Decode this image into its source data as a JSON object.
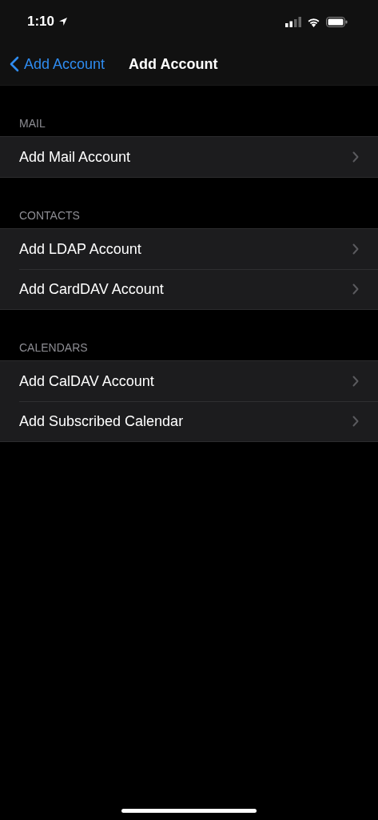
{
  "status_bar": {
    "time": "1:10"
  },
  "nav": {
    "back": "Add Account",
    "title": "Add Account"
  },
  "sections": [
    {
      "header": "MAIL",
      "rows": [
        {
          "label": "Add Mail Account"
        }
      ]
    },
    {
      "header": "CONTACTS",
      "rows": [
        {
          "label": "Add LDAP Account"
        },
        {
          "label": "Add CardDAV Account"
        }
      ]
    },
    {
      "header": "CALENDARS",
      "rows": [
        {
          "label": "Add CalDAV Account"
        },
        {
          "label": "Add Subscribed Calendar"
        }
      ]
    }
  ]
}
